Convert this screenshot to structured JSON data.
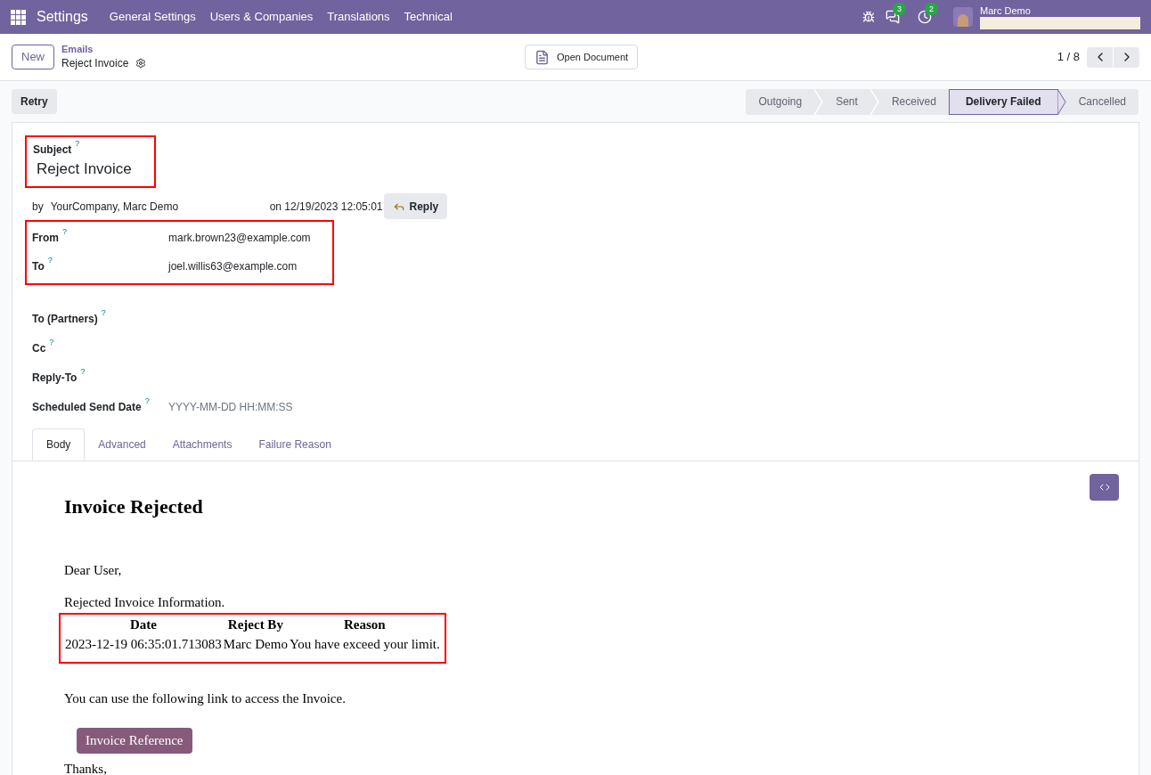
{
  "navbar": {
    "app_title": "Settings",
    "menu": [
      "General Settings",
      "Users & Companies",
      "Translations",
      "Technical"
    ],
    "chat_count": "3",
    "activity_count": "2",
    "user_name": "Marc Demo"
  },
  "control_panel": {
    "new_button": "New",
    "breadcrumb_parent": "Emails",
    "breadcrumb_current": "Reject Invoice",
    "open_document": "Open Document",
    "pager": "1 / 8"
  },
  "status_bar": {
    "retry": "Retry",
    "stages": [
      {
        "label": "Outgoing",
        "selected": false
      },
      {
        "label": "Sent",
        "selected": false
      },
      {
        "label": "Received",
        "selected": false
      },
      {
        "label": "Delivery Failed",
        "selected": true
      },
      {
        "label": "Cancelled",
        "selected": false
      }
    ]
  },
  "form": {
    "subject_label": "Subject",
    "subject_help": "?",
    "subject": "Reject Invoice",
    "by": "by",
    "authors": "YourCompany, Marc Demo",
    "date": "on 12/19/2023 12:05:01",
    "reply": "Reply",
    "addresses": [
      {
        "label": "From",
        "help": "?",
        "value": "mark.brown23@example.com"
      },
      {
        "label": "To",
        "help": "?",
        "value": "joel.willis63@example.com"
      }
    ],
    "fields": [
      {
        "label": "To (Partners)",
        "help": "?"
      },
      {
        "label": "Cc",
        "help": "?"
      },
      {
        "label": "Reply-To",
        "help": "?"
      },
      {
        "label": "Scheduled Send Date",
        "help": "?",
        "placeholder": "YYYY-MM-DD HH:MM:SS"
      }
    ],
    "tabs": [
      {
        "label": "Body",
        "selected": true
      },
      {
        "label": "Advanced",
        "selected": false
      },
      {
        "label": "Attachments",
        "selected": false
      },
      {
        "label": "Failure Reason",
        "selected": false
      }
    ],
    "body": {
      "heading": "Invoice Rejected",
      "greeting": "Dear User,",
      "intro": "Rejected Invoice Information.",
      "table": {
        "columns": [
          "Date",
          "Reject By",
          "Reason"
        ],
        "rows": [
          [
            "2023-12-19 06:35:01.713083",
            "Marc Demo",
            "You have exceed your limit."
          ]
        ]
      },
      "link_text": "You can use the following link to access the Invoice.",
      "link_button": "Invoice Reference",
      "closing": "Thanks,"
    }
  }
}
